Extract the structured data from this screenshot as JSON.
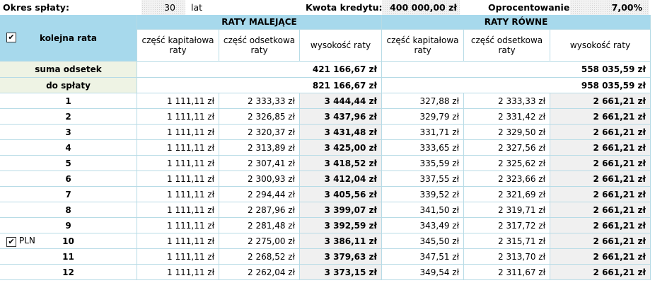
{
  "top": {
    "term_label": "Okres spłaty:",
    "term_value": "30",
    "term_unit": "lat",
    "amount_label": "Kwota kredytu:",
    "amount_value": "400 000,00 zł",
    "rate_label": "Oprocentowanie:",
    "rate_value": "7,00%"
  },
  "table": {
    "col_kolejna": "kolejna rata",
    "group_malejace": "RATY MALEJĄCE",
    "group_rowne": "RATY RÓWNE",
    "sub_kapital": "część kapitałowa raty",
    "sub_odsetki": "część odsetkowa raty",
    "sub_wysokosc": "wysokość raty",
    "sum_label": "suma odsetek",
    "sum_malejace": "421 166,67 zł",
    "sum_rowne": "558 035,59 zł",
    "pay_label": "do spłaty",
    "pay_malejace": "821 166,67 zł",
    "pay_rowne": "958 035,59 zł",
    "pln_label": "PLN",
    "rows": [
      {
        "n": "1",
        "mk": "1 111,11 zł",
        "mo": "2 333,33 zł",
        "mw": "3 444,44 zł",
        "rk": "327,88 zł",
        "ro": "2 333,33 zł",
        "rw": "2 661,21 zł"
      },
      {
        "n": "2",
        "mk": "1 111,11 zł",
        "mo": "2 326,85 zł",
        "mw": "3 437,96 zł",
        "rk": "329,79 zł",
        "ro": "2 331,42 zł",
        "rw": "2 661,21 zł"
      },
      {
        "n": "3",
        "mk": "1 111,11 zł",
        "mo": "2 320,37 zł",
        "mw": "3 431,48 zł",
        "rk": "331,71 zł",
        "ro": "2 329,50 zł",
        "rw": "2 661,21 zł"
      },
      {
        "n": "4",
        "mk": "1 111,11 zł",
        "mo": "2 313,89 zł",
        "mw": "3 425,00 zł",
        "rk": "333,65 zł",
        "ro": "2 327,56 zł",
        "rw": "2 661,21 zł"
      },
      {
        "n": "5",
        "mk": "1 111,11 zł",
        "mo": "2 307,41 zł",
        "mw": "3 418,52 zł",
        "rk": "335,59 zł",
        "ro": "2 325,62 zł",
        "rw": "2 661,21 zł"
      },
      {
        "n": "6",
        "mk": "1 111,11 zł",
        "mo": "2 300,93 zł",
        "mw": "3 412,04 zł",
        "rk": "337,55 zł",
        "ro": "2 323,66 zł",
        "rw": "2 661,21 zł"
      },
      {
        "n": "7",
        "mk": "1 111,11 zł",
        "mo": "2 294,44 zł",
        "mw": "3 405,56 zł",
        "rk": "339,52 zł",
        "ro": "2 321,69 zł",
        "rw": "2 661,21 zł"
      },
      {
        "n": "8",
        "mk": "1 111,11 zł",
        "mo": "2 287,96 zł",
        "mw": "3 399,07 zł",
        "rk": "341,50 zł",
        "ro": "2 319,71 zł",
        "rw": "2 661,21 zł"
      },
      {
        "n": "9",
        "mk": "1 111,11 zł",
        "mo": "2 281,48 zł",
        "mw": "3 392,59 zł",
        "rk": "343,49 zł",
        "ro": "2 317,72 zł",
        "rw": "2 661,21 zł"
      },
      {
        "n": "10",
        "mk": "1 111,11 zł",
        "mo": "2 275,00 zł",
        "mw": "3 386,11 zł",
        "rk": "345,50 zł",
        "ro": "2 315,71 zł",
        "rw": "2 661,21 zł"
      },
      {
        "n": "11",
        "mk": "1 111,11 zł",
        "mo": "2 268,52 zł",
        "mw": "3 379,63 zł",
        "rk": "347,51 zł",
        "ro": "2 313,70 zł",
        "rw": "2 661,21 zł"
      },
      {
        "n": "12",
        "mk": "1 111,11 zł",
        "mo": "2 262,04 zł",
        "mw": "3 373,15 zł",
        "rk": "349,54 zł",
        "ro": "2 311,67 zł",
        "rw": "2 661,21 zł"
      }
    ]
  }
}
